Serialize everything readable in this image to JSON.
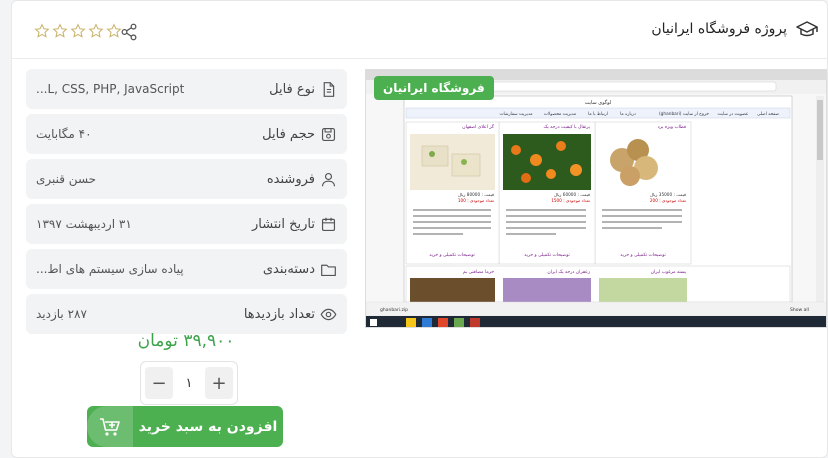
{
  "header": {
    "title": "پروژه فروشگاه ایرانیان",
    "rating_stars": 0,
    "rating_max": 5
  },
  "details": [
    {
      "label": "نوع فایل",
      "value": "...L, CSS, PHP, JavaScript",
      "icon": "file-icon"
    },
    {
      "label": "حجم فایل",
      "value": "۴۰ مگابایت",
      "icon": "disk-icon"
    },
    {
      "label": "فروشنده",
      "value": "حسن قنبری",
      "icon": "user-icon"
    },
    {
      "label": "تاریخ انتشار",
      "value": "۳۱ اردیبهشت ۱۳۹۷",
      "icon": "calendar-icon"
    },
    {
      "label": "دسته‌بندی",
      "value": "پیاده سازی سیستم های اط...",
      "icon": "folder-icon"
    },
    {
      "label": "تعداد بازدیدها",
      "value": "۲۸۷ بازدید",
      "icon": "eye-icon"
    }
  ],
  "price": "۳۹,۹۰۰ تومان",
  "quantity": "۱",
  "buy_label": "افزودن به سبد خرید",
  "preview": {
    "badge": "فروشگاه ایرانیان",
    "site_title": "لوگوی سایت",
    "nav": [
      "صفحه اصلی",
      "عضویت در سایت",
      "خروج از سایت (ghanbari)",
      "درباره ما",
      "ارتباط با ما",
      "مدیریت محصولات",
      "مدیریت سفارشات"
    ],
    "products": [
      {
        "name": "قطاب ویژه یزد",
        "price": "قیمت : 35000 ریال",
        "stock": "تعداد موجودی : 200",
        "more": "توضیحات تکمیلی و خرید"
      },
      {
        "name": "پرتقال با کیفیت درجه یک",
        "price": "قیمت : 60000 ریال",
        "stock": "تعداد موجودی : 1500",
        "more": "توضیحات تکمیلی و خرید"
      },
      {
        "name": "گز اعلای اصفهان",
        "price": "قیمت : 80000 ریال",
        "stock": "تعداد موجودی : 100",
        "more": "توضیحات تکمیلی و خرید"
      }
    ],
    "products_row2": [
      "پسته مرغوب ایران",
      "زعفران درجه یک ایران",
      "خرما مضافتی بم"
    ],
    "download_chip": "ghanbari.zip",
    "show_all": "Show all",
    "accent": "#4caf50",
    "price_color": "#3ca34b"
  }
}
